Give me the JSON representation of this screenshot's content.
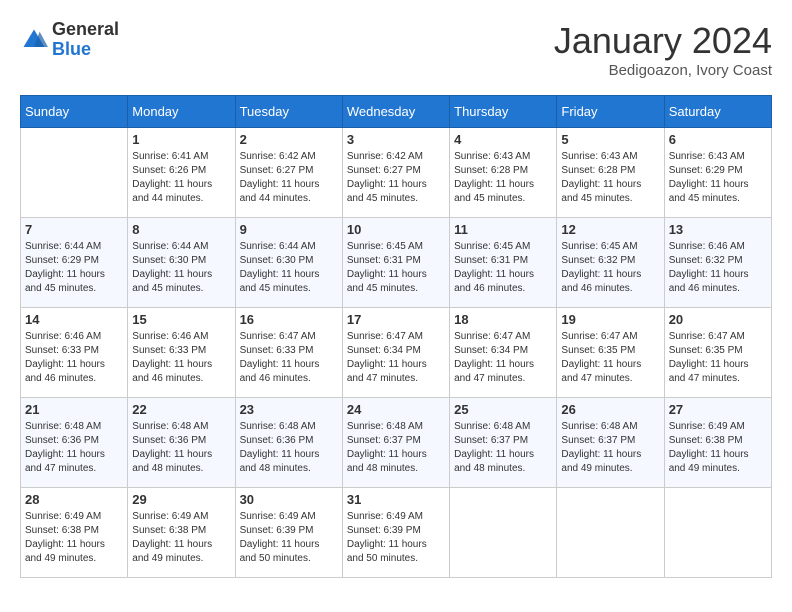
{
  "header": {
    "logo_general": "General",
    "logo_blue": "Blue",
    "month_title": "January 2024",
    "subtitle": "Bedigoazon, Ivory Coast"
  },
  "days_of_week": [
    "Sunday",
    "Monday",
    "Tuesday",
    "Wednesday",
    "Thursday",
    "Friday",
    "Saturday"
  ],
  "weeks": [
    [
      {
        "day": "",
        "sunrise": "",
        "sunset": "",
        "daylight": ""
      },
      {
        "day": "1",
        "sunrise": "Sunrise: 6:41 AM",
        "sunset": "Sunset: 6:26 PM",
        "daylight": "Daylight: 11 hours and 44 minutes."
      },
      {
        "day": "2",
        "sunrise": "Sunrise: 6:42 AM",
        "sunset": "Sunset: 6:27 PM",
        "daylight": "Daylight: 11 hours and 44 minutes."
      },
      {
        "day": "3",
        "sunrise": "Sunrise: 6:42 AM",
        "sunset": "Sunset: 6:27 PM",
        "daylight": "Daylight: 11 hours and 45 minutes."
      },
      {
        "day": "4",
        "sunrise": "Sunrise: 6:43 AM",
        "sunset": "Sunset: 6:28 PM",
        "daylight": "Daylight: 11 hours and 45 minutes."
      },
      {
        "day": "5",
        "sunrise": "Sunrise: 6:43 AM",
        "sunset": "Sunset: 6:28 PM",
        "daylight": "Daylight: 11 hours and 45 minutes."
      },
      {
        "day": "6",
        "sunrise": "Sunrise: 6:43 AM",
        "sunset": "Sunset: 6:29 PM",
        "daylight": "Daylight: 11 hours and 45 minutes."
      }
    ],
    [
      {
        "day": "7",
        "sunrise": "Sunrise: 6:44 AM",
        "sunset": "Sunset: 6:29 PM",
        "daylight": "Daylight: 11 hours and 45 minutes."
      },
      {
        "day": "8",
        "sunrise": "Sunrise: 6:44 AM",
        "sunset": "Sunset: 6:30 PM",
        "daylight": "Daylight: 11 hours and 45 minutes."
      },
      {
        "day": "9",
        "sunrise": "Sunrise: 6:44 AM",
        "sunset": "Sunset: 6:30 PM",
        "daylight": "Daylight: 11 hours and 45 minutes."
      },
      {
        "day": "10",
        "sunrise": "Sunrise: 6:45 AM",
        "sunset": "Sunset: 6:31 PM",
        "daylight": "Daylight: 11 hours and 45 minutes."
      },
      {
        "day": "11",
        "sunrise": "Sunrise: 6:45 AM",
        "sunset": "Sunset: 6:31 PM",
        "daylight": "Daylight: 11 hours and 46 minutes."
      },
      {
        "day": "12",
        "sunrise": "Sunrise: 6:45 AM",
        "sunset": "Sunset: 6:32 PM",
        "daylight": "Daylight: 11 hours and 46 minutes."
      },
      {
        "day": "13",
        "sunrise": "Sunrise: 6:46 AM",
        "sunset": "Sunset: 6:32 PM",
        "daylight": "Daylight: 11 hours and 46 minutes."
      }
    ],
    [
      {
        "day": "14",
        "sunrise": "Sunrise: 6:46 AM",
        "sunset": "Sunset: 6:33 PM",
        "daylight": "Daylight: 11 hours and 46 minutes."
      },
      {
        "day": "15",
        "sunrise": "Sunrise: 6:46 AM",
        "sunset": "Sunset: 6:33 PM",
        "daylight": "Daylight: 11 hours and 46 minutes."
      },
      {
        "day": "16",
        "sunrise": "Sunrise: 6:47 AM",
        "sunset": "Sunset: 6:33 PM",
        "daylight": "Daylight: 11 hours and 46 minutes."
      },
      {
        "day": "17",
        "sunrise": "Sunrise: 6:47 AM",
        "sunset": "Sunset: 6:34 PM",
        "daylight": "Daylight: 11 hours and 47 minutes."
      },
      {
        "day": "18",
        "sunrise": "Sunrise: 6:47 AM",
        "sunset": "Sunset: 6:34 PM",
        "daylight": "Daylight: 11 hours and 47 minutes."
      },
      {
        "day": "19",
        "sunrise": "Sunrise: 6:47 AM",
        "sunset": "Sunset: 6:35 PM",
        "daylight": "Daylight: 11 hours and 47 minutes."
      },
      {
        "day": "20",
        "sunrise": "Sunrise: 6:47 AM",
        "sunset": "Sunset: 6:35 PM",
        "daylight": "Daylight: 11 hours and 47 minutes."
      }
    ],
    [
      {
        "day": "21",
        "sunrise": "Sunrise: 6:48 AM",
        "sunset": "Sunset: 6:36 PM",
        "daylight": "Daylight: 11 hours and 47 minutes."
      },
      {
        "day": "22",
        "sunrise": "Sunrise: 6:48 AM",
        "sunset": "Sunset: 6:36 PM",
        "daylight": "Daylight: 11 hours and 48 minutes."
      },
      {
        "day": "23",
        "sunrise": "Sunrise: 6:48 AM",
        "sunset": "Sunset: 6:36 PM",
        "daylight": "Daylight: 11 hours and 48 minutes."
      },
      {
        "day": "24",
        "sunrise": "Sunrise: 6:48 AM",
        "sunset": "Sunset: 6:37 PM",
        "daylight": "Daylight: 11 hours and 48 minutes."
      },
      {
        "day": "25",
        "sunrise": "Sunrise: 6:48 AM",
        "sunset": "Sunset: 6:37 PM",
        "daylight": "Daylight: 11 hours and 48 minutes."
      },
      {
        "day": "26",
        "sunrise": "Sunrise: 6:48 AM",
        "sunset": "Sunset: 6:37 PM",
        "daylight": "Daylight: 11 hours and 49 minutes."
      },
      {
        "day": "27",
        "sunrise": "Sunrise: 6:49 AM",
        "sunset": "Sunset: 6:38 PM",
        "daylight": "Daylight: 11 hours and 49 minutes."
      }
    ],
    [
      {
        "day": "28",
        "sunrise": "Sunrise: 6:49 AM",
        "sunset": "Sunset: 6:38 PM",
        "daylight": "Daylight: 11 hours and 49 minutes."
      },
      {
        "day": "29",
        "sunrise": "Sunrise: 6:49 AM",
        "sunset": "Sunset: 6:38 PM",
        "daylight": "Daylight: 11 hours and 49 minutes."
      },
      {
        "day": "30",
        "sunrise": "Sunrise: 6:49 AM",
        "sunset": "Sunset: 6:39 PM",
        "daylight": "Daylight: 11 hours and 50 minutes."
      },
      {
        "day": "31",
        "sunrise": "Sunrise: 6:49 AM",
        "sunset": "Sunset: 6:39 PM",
        "daylight": "Daylight: 11 hours and 50 minutes."
      },
      {
        "day": "",
        "sunrise": "",
        "sunset": "",
        "daylight": ""
      },
      {
        "day": "",
        "sunrise": "",
        "sunset": "",
        "daylight": ""
      },
      {
        "day": "",
        "sunrise": "",
        "sunset": "",
        "daylight": ""
      }
    ]
  ]
}
